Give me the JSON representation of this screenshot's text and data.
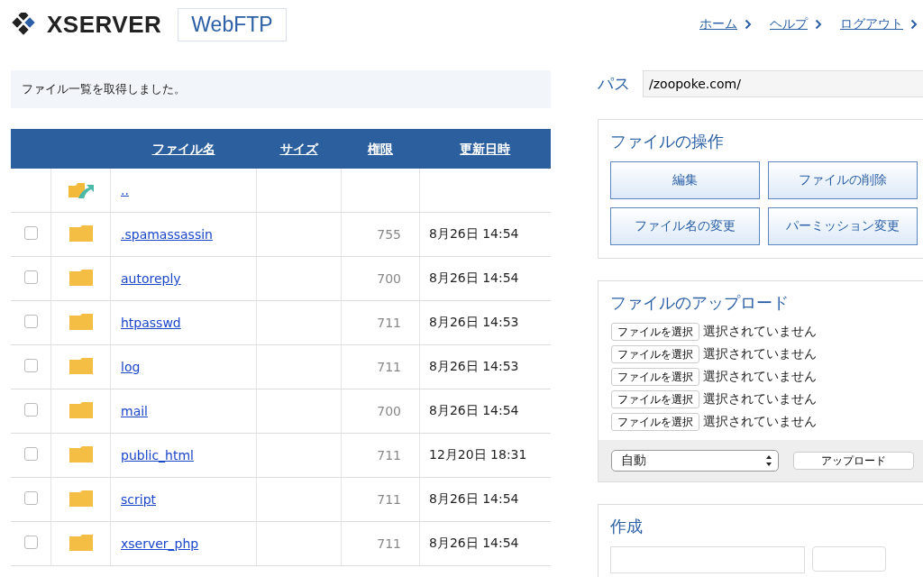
{
  "header": {
    "brand": "XSERVER",
    "product": "WebFTP",
    "nav": [
      "ホーム",
      "ヘルプ",
      "ログアウト"
    ]
  },
  "message": "ファイル一覧を取得しました。",
  "table": {
    "columns": [
      "ファイル名",
      "サイズ",
      "権限",
      "更新日時"
    ],
    "rows": [
      {
        "kind": "parent",
        "name": "..",
        "permission": "",
        "modified": ""
      },
      {
        "kind": "folder",
        "checked": false,
        "name": ".spamassassin",
        "permission": "755",
        "modified": "8月26日 14:54"
      },
      {
        "kind": "folder",
        "checked": false,
        "name": "autoreply",
        "permission": "700",
        "modified": "8月26日 14:54"
      },
      {
        "kind": "folder",
        "checked": false,
        "name": "htpasswd",
        "permission": "711",
        "modified": "8月26日 14:53"
      },
      {
        "kind": "folder",
        "checked": false,
        "name": "log",
        "permission": "711",
        "modified": "8月26日 14:53"
      },
      {
        "kind": "folder",
        "checked": false,
        "name": "mail",
        "permission": "700",
        "modified": "8月26日 14:54"
      },
      {
        "kind": "folder",
        "checked": false,
        "name": "public_html",
        "permission": "711",
        "modified": "12月20日 18:31"
      },
      {
        "kind": "folder",
        "checked": false,
        "name": "script",
        "permission": "711",
        "modified": "8月26日 14:54"
      },
      {
        "kind": "folder",
        "checked": false,
        "name": "xserver_php",
        "permission": "711",
        "modified": "8月26日 14:54"
      }
    ]
  },
  "path": {
    "label": "パス",
    "value": "/zoopoke.com/"
  },
  "operations": {
    "title": "ファイルの操作",
    "buttons": [
      "編集",
      "ファイルの削除",
      "ファイル名の変更",
      "パーミッション変更"
    ]
  },
  "upload": {
    "title": "ファイルのアップロード",
    "files": [
      {
        "button": "ファイルを選択",
        "status": "選択されていません"
      },
      {
        "button": "ファイルを選択",
        "status": "選択されていません"
      },
      {
        "button": "ファイルを選択",
        "status": "選択されていません"
      },
      {
        "button": "ファイルを選択",
        "status": "選択されていません"
      },
      {
        "button": "ファイルを選択",
        "status": "選択されていません"
      }
    ],
    "mode": "自動",
    "submit": "アップロード"
  },
  "create": {
    "title": "作成"
  }
}
